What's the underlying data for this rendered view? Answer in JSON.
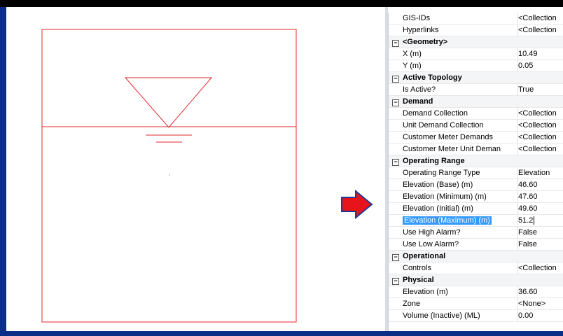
{
  "properties": {
    "rows": [
      {
        "kind": "prop",
        "name": "GIS-IDs",
        "value": "<Collection"
      },
      {
        "kind": "prop",
        "name": "Hyperlinks",
        "value": "<Collection"
      },
      {
        "kind": "cat",
        "name": "<Geometry>",
        "value": ""
      },
      {
        "kind": "prop",
        "name": "X (m)",
        "value": "10.49"
      },
      {
        "kind": "prop",
        "name": "Y (m)",
        "value": "0.05"
      },
      {
        "kind": "cat",
        "name": "Active Topology",
        "value": ""
      },
      {
        "kind": "prop",
        "name": "Is Active?",
        "value": "True"
      },
      {
        "kind": "cat",
        "name": "Demand",
        "value": ""
      },
      {
        "kind": "prop",
        "name": "Demand Collection",
        "value": "<Collection"
      },
      {
        "kind": "prop",
        "name": "Unit Demand Collection",
        "value": "<Collection"
      },
      {
        "kind": "prop",
        "name": "Customer Meter Demands",
        "value": "<Collection"
      },
      {
        "kind": "prop",
        "name": "Customer Meter Unit Deman",
        "value": "<Collection"
      },
      {
        "kind": "cat",
        "name": "Operating Range",
        "value": ""
      },
      {
        "kind": "prop",
        "name": "Operating Range Type",
        "value": "Elevation"
      },
      {
        "kind": "prop",
        "name": "Elevation (Base) (m)",
        "value": "46.60"
      },
      {
        "kind": "prop",
        "name": "Elevation (Minimum) (m)",
        "value": "47.60"
      },
      {
        "kind": "prop",
        "name": "Elevation (Initial) (m)",
        "value": "49.60"
      },
      {
        "kind": "prop",
        "name": "Elevation (Maximum) (m)",
        "value": "51.2",
        "selected": true
      },
      {
        "kind": "prop",
        "name": "Use High Alarm?",
        "value": "False"
      },
      {
        "kind": "prop",
        "name": "Use Low Alarm?",
        "value": "False"
      },
      {
        "kind": "cat",
        "name": "Operational",
        "value": ""
      },
      {
        "kind": "prop",
        "name": "Controls",
        "value": "<Collection"
      },
      {
        "kind": "cat",
        "name": "Physical",
        "value": ""
      },
      {
        "kind": "prop",
        "name": "Elevation (m)",
        "value": "36.60"
      },
      {
        "kind": "prop",
        "name": "Zone",
        "value": "<None>"
      },
      {
        "kind": "prop",
        "name": "Volume (Inactive) (ML)",
        "value": "0.00"
      }
    ],
    "collapse_glyph": "−"
  },
  "colors": {
    "tank_stroke": "#e0282e",
    "arrow_fill": "#e8141b",
    "arrow_stroke": "#1f3a93",
    "selection": "#3399ff",
    "frame": "#0b2f86"
  },
  "icons": {
    "arrow": "right-arrow-icon",
    "tank": "tank-symbol"
  }
}
